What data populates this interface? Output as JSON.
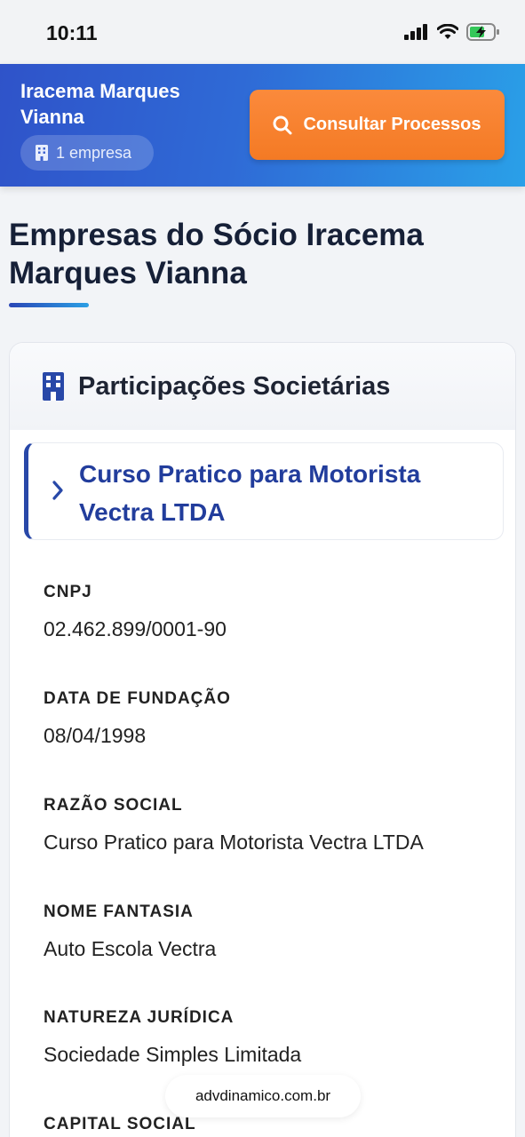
{
  "status_bar": {
    "time": "10:11"
  },
  "header": {
    "name": "Iracema Marques Vianna",
    "company_count": "1 empresa",
    "consult_button": "Consultar Processos"
  },
  "page": {
    "title": "Empresas do Sócio Iracema Marques Vianna"
  },
  "card": {
    "title": "Participações Societárias",
    "company": {
      "name": "Curso Pratico para Motorista Vectra LTDA",
      "fields": [
        {
          "label": "CNPJ",
          "value": "02.462.899/0001-90"
        },
        {
          "label": "DATA DE FUNDAÇÃO",
          "value": "08/04/1998"
        },
        {
          "label": "RAZÃO SOCIAL",
          "value": "Curso Pratico para Motorista Vectra LTDA"
        },
        {
          "label": "NOME FANTASIA",
          "value": "Auto Escola Vectra"
        },
        {
          "label": "NATUREZA JURÍDICA",
          "value": "Sociedade Simples Limitada"
        },
        {
          "label": "CAPITAL SOCIAL",
          "value": ""
        }
      ]
    }
  },
  "browser": {
    "url": "advdinamico.com.br"
  },
  "colors": {
    "header_gradient_start": "#2f53c9",
    "header_gradient_end": "#2aa0e8",
    "button_orange": "#f47a24",
    "company_name_blue": "#223d9c"
  },
  "icons": [
    "signal-icon",
    "wifi-icon",
    "battery-charging-icon",
    "building-icon",
    "search-icon",
    "chevron-right-icon"
  ]
}
